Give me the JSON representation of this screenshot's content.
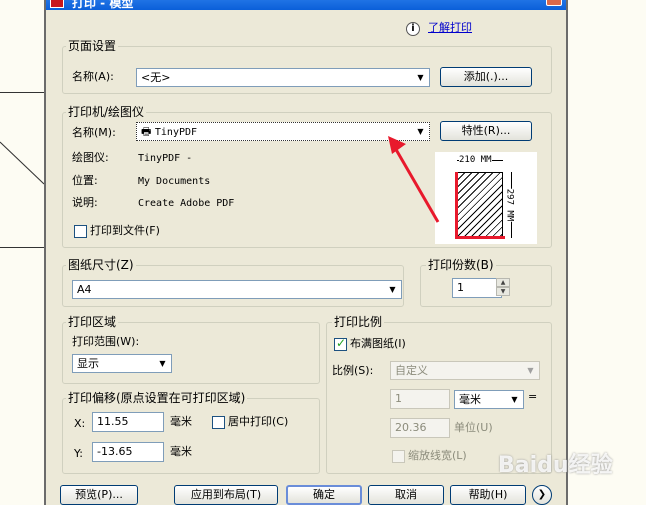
{
  "window": {
    "title": "打印 - 模型"
  },
  "help_link": "了解打印",
  "page_setup": {
    "group_label": "页面设置",
    "name_label": "名称(A):",
    "name_value": "<无>",
    "add_button": "添加(.)..."
  },
  "printer": {
    "group_label": "打印机/绘图仪",
    "name_label": "名称(M):",
    "name_value": "TinyPDF",
    "properties_button": "特性(R)...",
    "plotter_label": "绘图仪:",
    "plotter_value": "TinyPDF -",
    "location_label": "位置:",
    "location_value": "My Documents",
    "description_label": "说明:",
    "description_value": "Create Adobe PDF",
    "print_to_file": "打印到文件(F)",
    "preview_width": "210 MM",
    "preview_height": "297 MM"
  },
  "paper_size": {
    "group_label": "图纸尺寸(Z)",
    "value": "A4"
  },
  "copies": {
    "group_label": "打印份数(B)",
    "value": "1"
  },
  "print_area": {
    "group_label": "打印区域",
    "range_label": "打印范围(W):",
    "range_value": "显示"
  },
  "print_scale": {
    "group_label": "打印比例",
    "fit_to_paper": "布满图纸(I)",
    "scale_label": "比例(S):",
    "scale_value": "自定义",
    "value1": "1",
    "unit_value": "毫米",
    "equals": "=",
    "value2": "20.36",
    "unit_label": "单位(U)",
    "scale_lineweights": "缩放线宽(L)"
  },
  "offset": {
    "group_label": "打印偏移(原点设置在可打印区域)",
    "x_label": "X:",
    "x_value": "11.55",
    "x_unit": "毫米",
    "center_plot": "居中打印(C)",
    "y_label": "Y:",
    "y_value": "-13.65",
    "y_unit": "毫米"
  },
  "buttons": {
    "preview": "预览(P)...",
    "apply_to_layout": "应用到布局(T)",
    "ok": "确定",
    "cancel": "取消",
    "help": "帮助(H)",
    "more": "❯"
  },
  "watermark": "Baidu经验",
  "colors": {
    "accent_red": "#e8192c",
    "title_blue": "#0a5fd9"
  }
}
